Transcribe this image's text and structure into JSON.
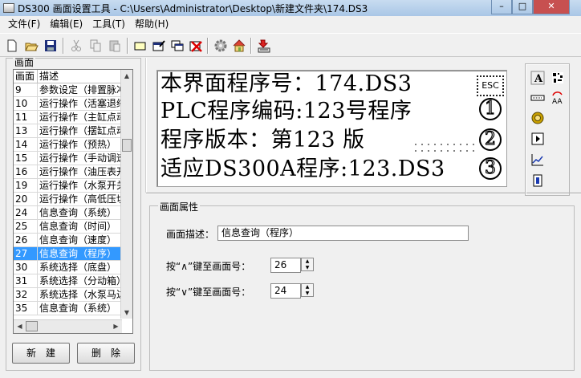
{
  "window": {
    "title": "DS300 画面设置工具 - C:\\Users\\Administrator\\Desktop\\新建文件夹\\174.DS3"
  },
  "menu": [
    "文件(F)",
    "编辑(E)",
    "工具(T)",
    "帮助(H)"
  ],
  "left": {
    "group_title": "画面",
    "columns": [
      "画面",
      "描述"
    ],
    "rows": [
      {
        "id": "9",
        "desc": "参数设定（排置脉冲"
      },
      {
        "id": "10",
        "desc": "运行操作（活塞退缩"
      },
      {
        "id": "11",
        "desc": "运行操作（主缸点动"
      },
      {
        "id": "13",
        "desc": "运行操作（摆缸点动"
      },
      {
        "id": "14",
        "desc": "运行操作（预热）"
      },
      {
        "id": "15",
        "desc": "运行操作（手动调速"
      },
      {
        "id": "16",
        "desc": "运行操作（油压表开"
      },
      {
        "id": "19",
        "desc": "运行操作（水泵开关"
      },
      {
        "id": "20",
        "desc": "运行操作（高低压切"
      },
      {
        "id": "24",
        "desc": "信息查询（系统）"
      },
      {
        "id": "25",
        "desc": "信息查询（时间）"
      },
      {
        "id": "26",
        "desc": "信息查询（速度）"
      },
      {
        "id": "27",
        "desc": "信息查询（程序）"
      },
      {
        "id": "30",
        "desc": "系统选择（底盘）"
      },
      {
        "id": "31",
        "desc": "系统选择（分动箱）"
      },
      {
        "id": "32",
        "desc": "系统选择（水泵马达"
      },
      {
        "id": "35",
        "desc": "信息查询（系统）"
      }
    ],
    "selected_id": "27",
    "new_button": "新　建",
    "delete_button": "删　除"
  },
  "preview": {
    "lines": [
      "本界面程序号：174.DS3",
      "PLC程序编码:123号程序",
      "程序版本：第123 版",
      "适应DS300A程序:123.DS3"
    ],
    "icon_box_text": "ESC",
    "circled": [
      "1",
      "2",
      "3"
    ]
  },
  "properties": {
    "group_title": "画面属性",
    "desc_label": "画面描述：",
    "desc_value": "信息查询（程序）",
    "up_label": "按“∧”键至画面号：",
    "up_value": "26",
    "down_label": "按“∨”键至画面号：",
    "down_value": "24"
  },
  "toolbar_icons": [
    "new-file-icon",
    "open-folder-icon",
    "save-icon",
    "cut-icon",
    "copy-icon",
    "paste-icon",
    "rectangle-icon",
    "window-edit-icon",
    "window-copy-icon",
    "window-delete-icon",
    "settings-gear-icon",
    "home-icon",
    "export-icon"
  ],
  "right_tools": [
    "text-tool-icon",
    "bitmap-tool-icon",
    "input-field-tool-icon",
    "swap-text-tool-icon",
    "lamp-tool-icon",
    "button-tool-icon",
    "trend-chart-tool-icon",
    "meter-tool-icon"
  ],
  "colors": {
    "selection": "#3399ff",
    "titlebar": "#b4cde8"
  }
}
